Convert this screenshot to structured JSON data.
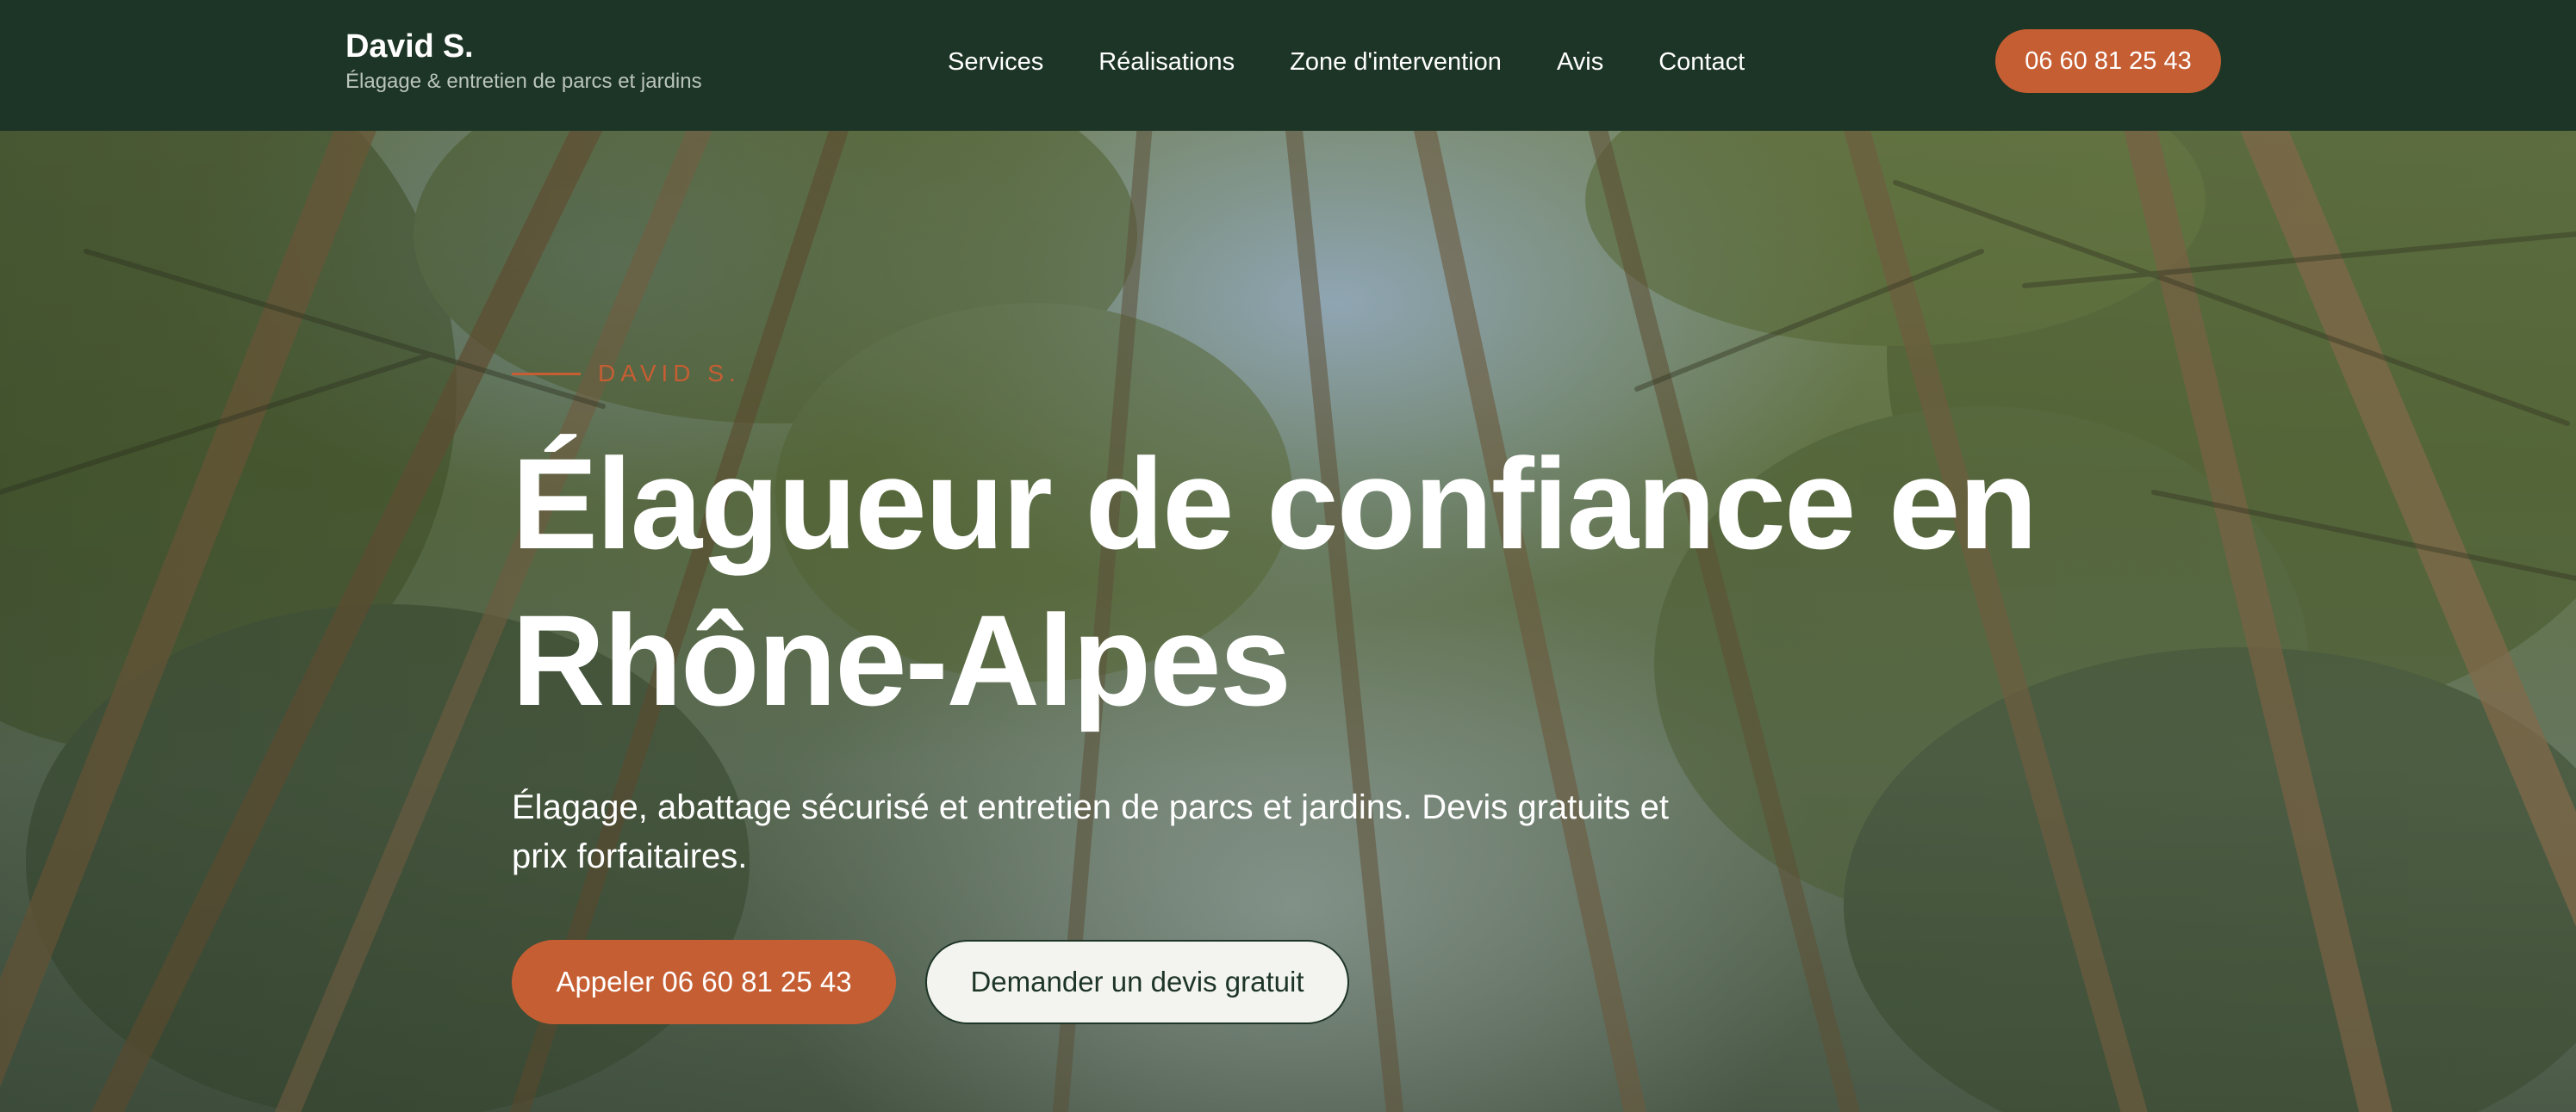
{
  "header": {
    "brand_name": "David S.",
    "tagline": "Élagage & entretien de parcs et jardins",
    "nav": [
      {
        "label": "Services"
      },
      {
        "label": "Réalisations"
      },
      {
        "label": "Zone d'intervention"
      },
      {
        "label": "Avis"
      },
      {
        "label": "Contact"
      }
    ],
    "phone_button": "06 60 81 25 43"
  },
  "hero": {
    "eyebrow": "DAVID S.",
    "title": "Élagueur de confiance en Rhône-Alpes",
    "subtitle": "Élagage, abattage sécurisé et entretien de parcs et jardins. Devis gratuits et prix forfaitaires.",
    "call_button": "Appeler 06 60 81 25 43",
    "quote_button": "Demander un devis gratuit",
    "background_image": "forest-canopy-looking-up"
  },
  "colors": {
    "header_bg": "#1d3526",
    "accent": "#c65e33",
    "light_button_bg": "#f3f4ef",
    "text_light": "#ffffff"
  }
}
